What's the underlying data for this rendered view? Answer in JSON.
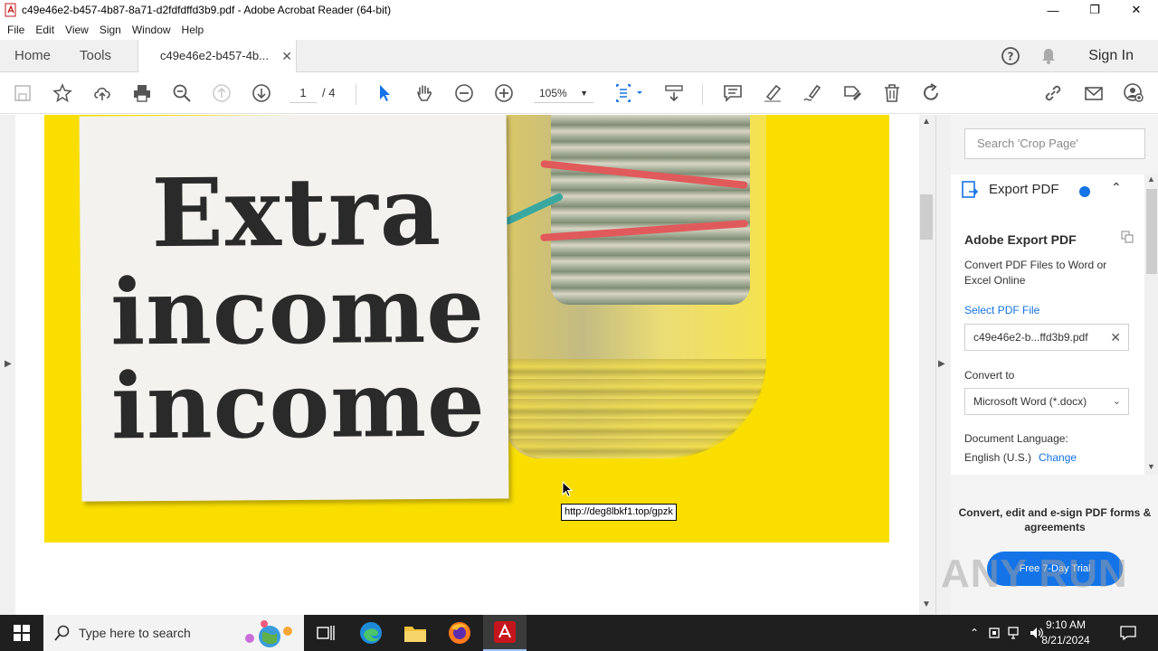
{
  "window": {
    "title": "c49e46e2-b457-4b87-8a71-d2fdfdffd3b9.pdf - Adobe Acrobat Reader (64-bit)"
  },
  "menu": [
    "File",
    "Edit",
    "View",
    "Sign",
    "Window",
    "Help"
  ],
  "tabs": {
    "home": "Home",
    "tools": "Tools",
    "document": "c49e46e2-b457-4b...",
    "sign_in": "Sign In"
  },
  "toolbar": {
    "current_page": "1",
    "total_pages": "/ 4",
    "zoom": "105%"
  },
  "page_content": {
    "line1": "Extra",
    "line2": "income",
    "line3": "income",
    "link_tooltip": "http://deg8lbkf1.top/gpzk"
  },
  "right_panel": {
    "search_placeholder": "Search 'Crop Page'",
    "export_header": "Export PDF",
    "title": "Adobe Export PDF",
    "description": "Convert PDF Files to Word or Excel Online",
    "select_file_link": "Select PDF File",
    "file_name": "c49e46e2-b...ffd3b9.pdf",
    "convert_to_label": "Convert to",
    "convert_to_value": "Microsoft Word (*.docx)",
    "doc_language_label": "Document Language:",
    "doc_language_value": "English (U.S.)",
    "change_link": "Change",
    "promo_text": "Convert, edit and e-sign PDF forms & agreements",
    "trial_button": "Free 7-Day Trial"
  },
  "watermark": "ANY RUN",
  "taskbar": {
    "search_placeholder": "Type here to search",
    "time": "9:10 AM",
    "date": "8/21/2024"
  },
  "colors": {
    "accent": "#1473e6",
    "page_background": "#f9de00",
    "taskbar": "#1f1f1f"
  }
}
